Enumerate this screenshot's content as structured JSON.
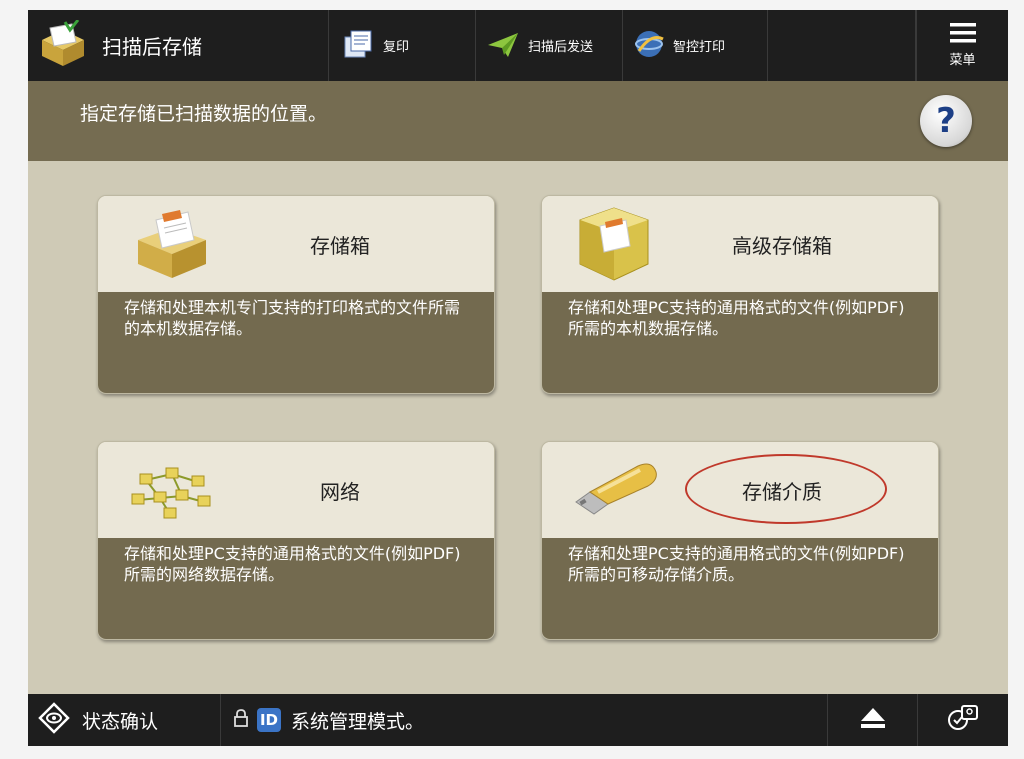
{
  "topbar": {
    "active_tab": {
      "label": "扫描后存储",
      "icon": "open-box-icon"
    },
    "tabs": [
      {
        "label": "复印",
        "icon": "copy-documents-icon"
      },
      {
        "label": "扫描后发送",
        "icon": "paper-plane-icon"
      },
      {
        "label": "智控打印",
        "icon": "globe-print-icon"
      }
    ],
    "menu": {
      "label": "菜单",
      "icon": "hamburger-menu-icon"
    }
  },
  "instruction": {
    "text": "指定存储已扫描数据的位置。",
    "help_symbol": "?"
  },
  "options": [
    {
      "title": "存储箱",
      "description": "存储和处理本机专门支持的打印格式的文件所需的本机数据存储。",
      "icon": "storage-box-icon"
    },
    {
      "title": "高级存储箱",
      "description": "存储和处理PC支持的通用格式的文件(例如PDF)所需的本机数据存储。",
      "icon": "advanced-storage-box-icon"
    },
    {
      "title": "网络",
      "description": "存储和处理PC支持的通用格式的文件(例如PDF)所需的网络数据存储。",
      "icon": "network-nodes-icon"
    },
    {
      "title": "存储介质",
      "description": "存储和处理PC支持的通用格式的文件(例如PDF)所需的可移动存储介质。",
      "icon": "usb-drive-icon",
      "highlighted": true
    }
  ],
  "bottombar": {
    "status": {
      "label": "状态确认",
      "icon": "status-eye-icon"
    },
    "mode": {
      "label": "系统管理模式。",
      "badge": "ID"
    },
    "eject_icon": "eject-icon",
    "switch_icon": "switch-user-icon"
  },
  "colors": {
    "accent_bar": "#756c51",
    "card_desc_bg": "#736a4f",
    "highlight_circle": "#c0392b",
    "help_question": "#1d3f86"
  }
}
